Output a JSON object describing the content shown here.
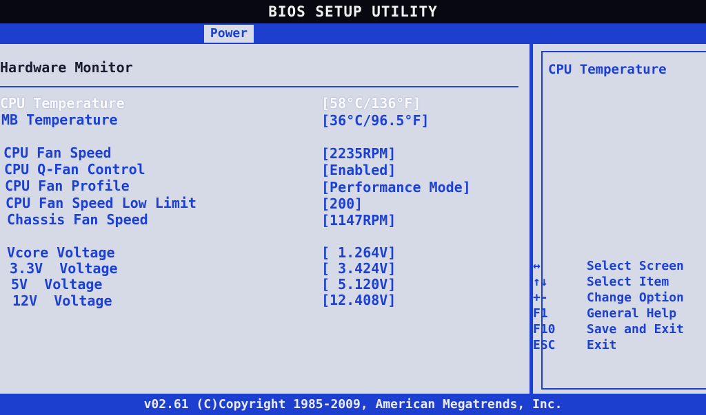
{
  "window": {
    "title": "BIOS SETUP UTILITY"
  },
  "tabs": [
    {
      "label": "Power",
      "active": true
    }
  ],
  "main": {
    "section_title": "Hardware Monitor",
    "rows": [
      {
        "label": "CPU Temperature",
        "value": "[58°C/136°F]",
        "selected": true
      },
      {
        "label": "MB Temperature",
        "value": "[36°C/96.5°F]"
      },
      {
        "label": "CPU Fan Speed",
        "value": "[2235RPM]"
      },
      {
        "label": "CPU Q-Fan Control",
        "value": "[Enabled]"
      },
      {
        "label": "CPU Fan Profile",
        "value": "[Performance Mode]"
      },
      {
        "label": "CPU Fan Speed Low Limit",
        "value": "[200]"
      },
      {
        "label": "Chassis Fan Speed",
        "value": "[1147RPM]"
      },
      {
        "label": "Vcore Voltage",
        "value": "[ 1.264V]"
      },
      {
        "label": "3.3V  Voltage",
        "value": "[ 3.424V]"
      },
      {
        "label": "5V  Voltage",
        "value": "[ 5.120V]"
      },
      {
        "label": "12V  Voltage",
        "value": "[12.408V]"
      }
    ]
  },
  "help": {
    "title": "CPU Temperature",
    "keys": [
      {
        "key": "↔",
        "desc": "Select Screen",
        "icon": "left-right-arrow-icon"
      },
      {
        "key": "↑↓",
        "desc": "Select Item",
        "icon": "up-down-arrow-icon"
      },
      {
        "key": "+-",
        "desc": "Change Option",
        "icon": "plus-minus-icon"
      },
      {
        "key": "F1",
        "desc": "General Help"
      },
      {
        "key": "F10",
        "desc": "Save and Exit"
      },
      {
        "key": "ESC",
        "desc": "Exit"
      }
    ]
  },
  "footer": {
    "text": "v02.61 (C)Copyright 1985-2009, American Megatrends, Inc."
  },
  "colors": {
    "panel_bg": "#d6dae6",
    "accent_blue": "#1d3fd0",
    "text_blue": "#1c40d4",
    "selected_text": "#fbfbfd"
  }
}
